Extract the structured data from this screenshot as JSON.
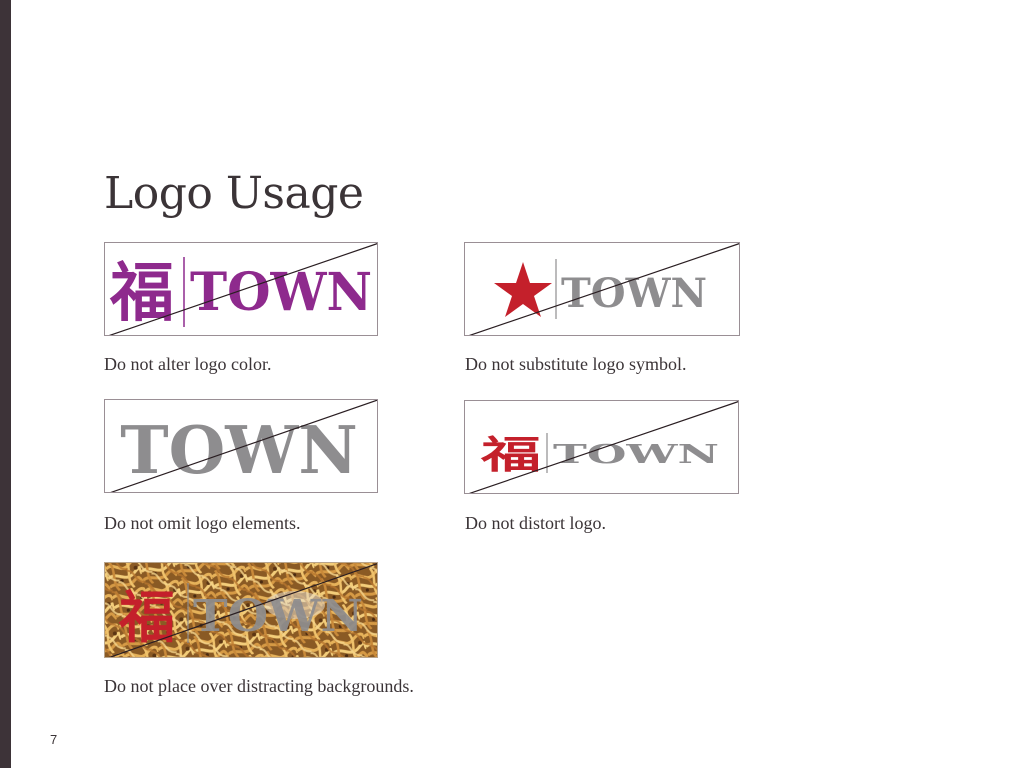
{
  "page": {
    "title": "Logo Usage",
    "page_number": "7"
  },
  "colors": {
    "sidebar": "#3d3338",
    "purple": "#8e2a8d",
    "red": "#c4202b",
    "gray": "#8e8d8f",
    "strike_line": "#2a1e22"
  },
  "logo": {
    "symbol_char": "福",
    "wordmark": "TOWN"
  },
  "examples": [
    {
      "caption": "Do not alter logo color.",
      "icon": "purple-logo-recolored"
    },
    {
      "caption": "Do not substitute logo symbol.",
      "icon": "star-symbol-substituted"
    },
    {
      "caption": "Do not omit logo elements.",
      "icon": "wordmark-only"
    },
    {
      "caption": "Do not distort logo.",
      "icon": "stretched-logo"
    },
    {
      "caption": "Do not place over distracting backgrounds.",
      "icon": "noodle-background-logo"
    }
  ]
}
